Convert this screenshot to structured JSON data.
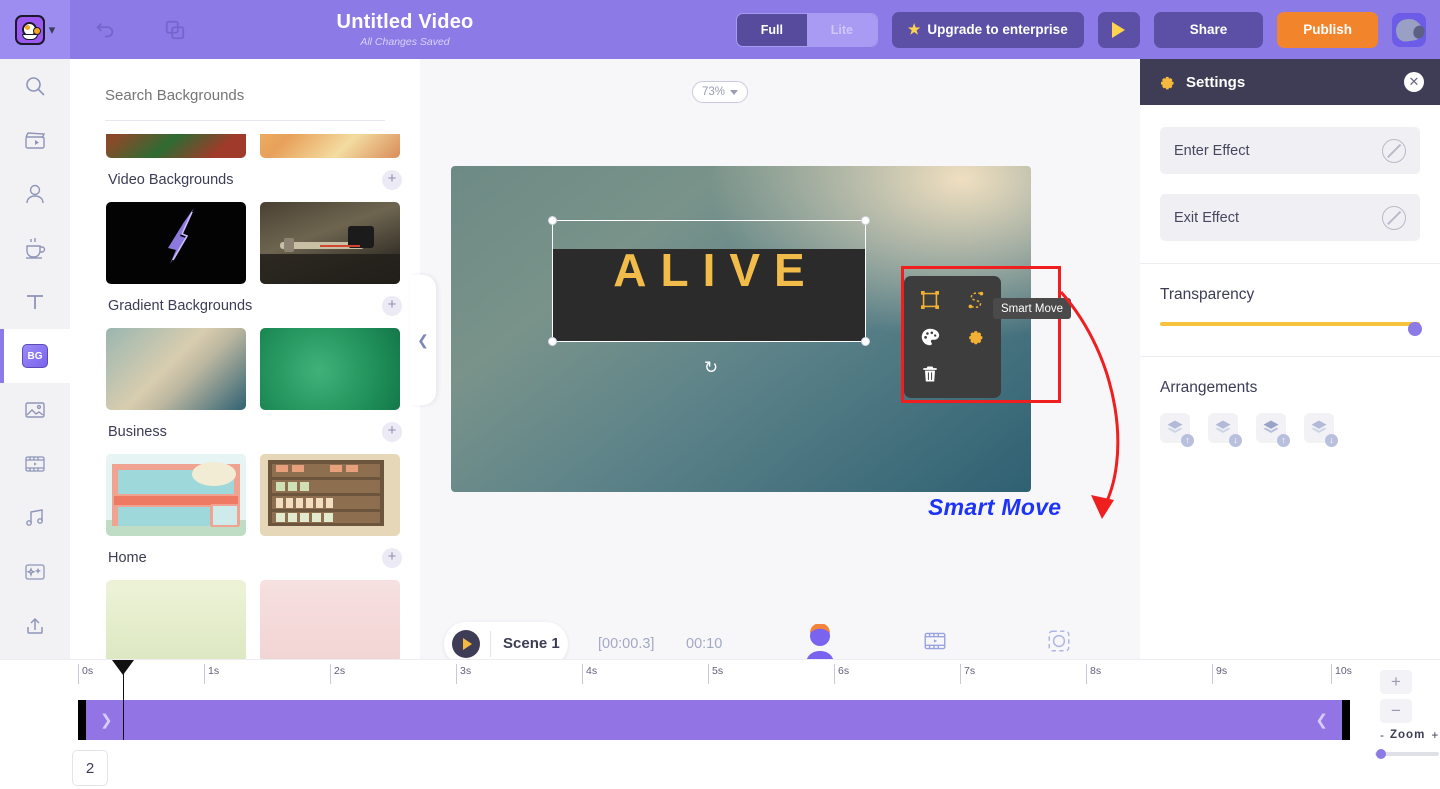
{
  "topbar": {
    "title": "Untitled Video",
    "save_status": "All Changes Saved",
    "mode_full": "Full",
    "mode_lite": "Lite",
    "upgrade_label": "Upgrade to enterprise",
    "share_label": "Share",
    "publish_label": "Publish",
    "accent_purple": "#8c7ae6",
    "accent_orange": "#f2842c"
  },
  "rail": {
    "items": [
      {
        "name": "search",
        "label": "Search"
      },
      {
        "name": "scenes",
        "label": "Scenes"
      },
      {
        "name": "characters",
        "label": "Characters"
      },
      {
        "name": "props",
        "label": "Props"
      },
      {
        "name": "text",
        "label": "Text"
      },
      {
        "name": "backgrounds",
        "label": "BG"
      },
      {
        "name": "images",
        "label": "Images"
      },
      {
        "name": "videos",
        "label": "Videos"
      },
      {
        "name": "music",
        "label": "Music"
      },
      {
        "name": "effects",
        "label": "Effects"
      },
      {
        "name": "upload",
        "label": "Upload"
      }
    ]
  },
  "backgrounds": {
    "search_placeholder": "Search Backgrounds",
    "search_value": "",
    "sections": [
      {
        "title": "Video Backgrounds",
        "add": "+"
      },
      {
        "title": "Gradient Backgrounds",
        "add": "+"
      },
      {
        "title": "Business",
        "add": "+"
      },
      {
        "title": "Home",
        "add": "+"
      }
    ]
  },
  "canvas": {
    "zoom_level": "73%",
    "text_element": "ALIVE",
    "text_color": "#f2bc4b",
    "band_color": "#2b2b2b",
    "toolbar_buttons": [
      "smart-move",
      "trim-path",
      "color-palette",
      "settings-gear",
      "delete"
    ],
    "tooltip": "Smart Move",
    "annotation_label": "Smart Move",
    "annotation_color": "#1d33f5",
    "highlight_color": "#f01f1f"
  },
  "scene": {
    "name": "Scene 1",
    "current_time": "[00:00.3]",
    "duration": "00:10",
    "icons": [
      "character-icon",
      "video-icon",
      "focus-icon"
    ]
  },
  "settings": {
    "title": "Settings",
    "enter_effect": "Enter Effect",
    "exit_effect": "Exit Effect",
    "transparency_label": "Transparency",
    "transparency_value": 100,
    "arrangements_label": "Arrangements",
    "arrangement_buttons": [
      {
        "name": "bring-forward",
        "badge": "↑"
      },
      {
        "name": "send-backward",
        "badge": "↓"
      },
      {
        "name": "bring-to-front",
        "badge": "↑"
      },
      {
        "name": "send-to-back",
        "badge": "↓"
      }
    ],
    "slider_track_color": "#f5c33c",
    "knob_color": "#8c7ae6"
  },
  "timeline": {
    "ticks": [
      "0s",
      "1s",
      "2s",
      "3s",
      "4s",
      "5s",
      "6s",
      "7s",
      "8s",
      "9s",
      "10s"
    ],
    "scene_number": "2",
    "zoom_label": "Zoom",
    "zoom_minus": "-",
    "zoom_plus": "+",
    "track_color": "#9274e4"
  }
}
